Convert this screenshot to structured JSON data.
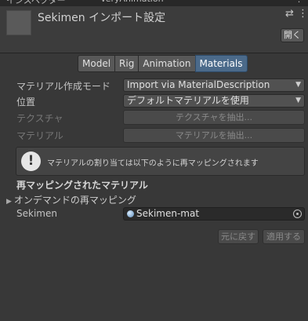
{
  "tabs": {
    "inspector_label": "インスペクター",
    "animation_label": "VeryAnimation"
  },
  "header": {
    "title": "Sekimen インポート設定",
    "open_label": "開く"
  },
  "segments": [
    {
      "label": "Model",
      "active": false
    },
    {
      "label": "Rig",
      "active": false
    },
    {
      "label": "Animation",
      "active": false
    },
    {
      "label": "Materials",
      "active": true
    }
  ],
  "materials": {
    "creation_mode_label": "マテリアル作成モード",
    "creation_mode_value": "Import via MaterialDescription",
    "location_label": "位置",
    "location_value": "デフォルトマテリアルを使用",
    "textures_label": "テクスチャ",
    "extract_textures_label": "テクスチャを抽出...",
    "materials_label": "マテリアル",
    "extract_materials_label": "マテリアルを抽出...",
    "help_text": "マテリアルの割り当ては以下のように再マッピングされます",
    "remapped_title": "再マッピングされたマテリアル",
    "on_demand_label": "オンデマンドの再マッピング",
    "entry_label": "Sekimen",
    "entry_value": "Sekimen-mat"
  },
  "footer": {
    "revert_label": "元に戻す",
    "apply_label": "適用する"
  }
}
